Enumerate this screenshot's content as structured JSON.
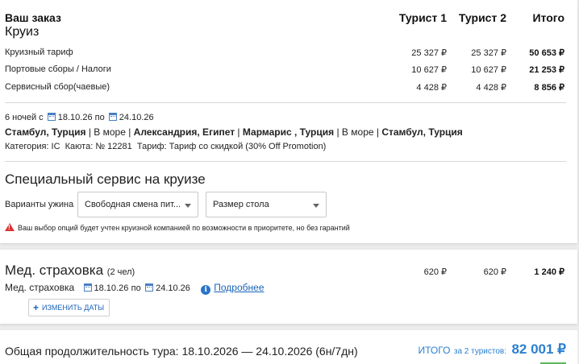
{
  "order": {
    "heading": "Ваш заказ",
    "subheading": "Круиз",
    "columns": [
      "Турист 1",
      "Турист 2",
      "Итого"
    ],
    "rows": [
      {
        "label": "Круизный тариф",
        "t1": "25 327 ₽",
        "t2": "25 327 ₽",
        "total": "50 653 ₽"
      },
      {
        "label": "Портовые сборы / Налоги",
        "t1": "10 627 ₽",
        "t2": "10 627 ₽",
        "total": "21 253 ₽"
      },
      {
        "label": "Сервисный сбор(чаевые)",
        "t1": "4 428 ₽",
        "t2": "4 428 ₽",
        "total": "8 856 ₽"
      }
    ]
  },
  "cruise": {
    "nights_prefix": "6 ночей с",
    "date_from": "18.10.26",
    "date_sep": "по",
    "date_to": "24.10.26",
    "route": [
      {
        "text": "Стамбул, Турция",
        "bold": true
      },
      {
        "text": " | В море | ",
        "bold": false
      },
      {
        "text": "Александрия, Египет",
        "bold": true
      },
      {
        "text": " | ",
        "bold": false
      },
      {
        "text": "Мармарис , Турция",
        "bold": true
      },
      {
        "text": " | В море | ",
        "bold": false
      },
      {
        "text": "Стамбул, Турция",
        "bold": true
      }
    ],
    "details": "Категория: IC  Каюта: № 12281  Тариф: Тариф со скидкой (30% Off Promotion)"
  },
  "service": {
    "title": "Специальный сервис на круизе",
    "dinner_label": "Варианты ужина",
    "dinner_value": "Свободная смена пит...",
    "table_value": "Размер стола",
    "warning": "Ваш выбор опций будет учтен круизной компанией по возможности в приоритете, но без гарантий"
  },
  "insurance": {
    "title": "Мед. страховка",
    "people": "(2 чел)",
    "t1": "620 ₽",
    "t2": "620 ₽",
    "total": "1 240 ₽",
    "row_label": "Мед. страховка",
    "date_from": "18.10.26",
    "date_sep": "по",
    "date_to": "24.10.26",
    "more_link": "Подробнее",
    "change_dates_button": "ИЗМЕНИТЬ ДАТЫ"
  },
  "summary": {
    "duration": "Общая продолжительность тура: 18.10.2026 — 24.10.2026 (6н/7дн)",
    "total_label": "ИТОГО",
    "total_sub": "за 2 туристов:",
    "total_value": "82 001 ₽"
  },
  "colors": {
    "accent": "#1a63b8",
    "total": "#2a7fd0",
    "warning": "#dd3333"
  }
}
